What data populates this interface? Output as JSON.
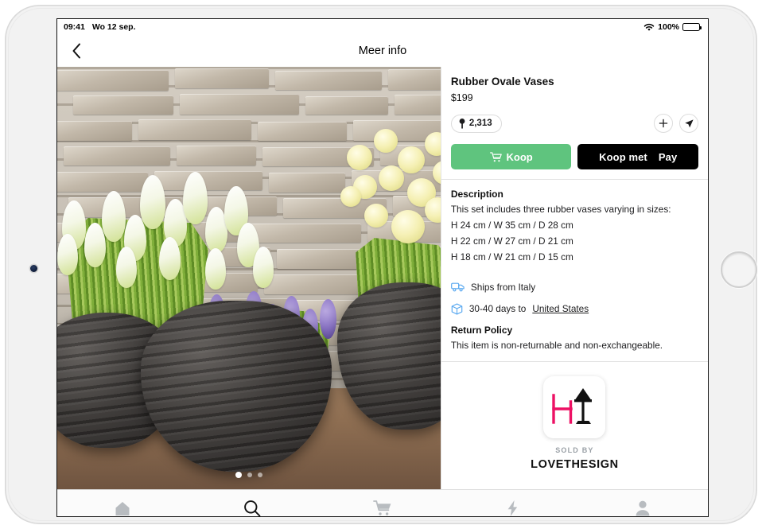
{
  "status_bar": {
    "time": "09:41",
    "date": "Wo 12 sep.",
    "wifi_icon": "wifi-icon",
    "battery_percent": "100%",
    "battery_icon": "battery-full-icon"
  },
  "nav": {
    "back_icon": "chevron-left-icon",
    "title": "Meer info"
  },
  "gallery": {
    "image_alt": "Three dark rubber vases with white tulips, purple grape hyacinths and cream ranunculus against a stone brick wall",
    "dots": [
      {
        "active": true
      },
      {
        "active": false
      },
      {
        "active": false
      }
    ]
  },
  "product": {
    "title": "Rubber Ovale Vases",
    "price": "$199",
    "like_count": "2,313",
    "like_icon": "pin-icon",
    "add_icon": "plus-icon",
    "share_icon": "send-icon",
    "buy_button": {
      "label": "Koop",
      "icon": "cart-icon",
      "color": "#5fc47e"
    },
    "apple_pay_button": {
      "prefix": "Koop met",
      "apple_logo": "",
      "suffix": "Pay",
      "color": "#000000"
    }
  },
  "description": {
    "heading": "Description",
    "lines": [
      "This set includes three rubber vases varying in sizes:",
      "H 24 cm / W 35 cm / D 28 cm",
      "H 22 cm / W 27 cm / D 21 cm",
      "H 18 cm / W 21 cm / D 15 cm"
    ]
  },
  "shipping": {
    "ships_from": {
      "icon": "truck-icon",
      "text": "Ships from Italy",
      "icon_color": "#5aa9f0"
    },
    "delivery": {
      "icon": "box-icon",
      "text": "30-40 days to",
      "destination": "United States",
      "icon_color": "#5aa9f0"
    }
  },
  "return_policy": {
    "heading": "Return Policy",
    "text": "This item is non-returnable and non-exchangeable."
  },
  "seller": {
    "logo_icon": "chair-and-lamp-logo",
    "logo_chair_color": "#ed1164",
    "logo_lamp_color": "#111111",
    "sold_by_label": "SOLD BY",
    "name": "LOVETHESIGN"
  },
  "tabbar": {
    "items": [
      {
        "name": "tab-home",
        "icon": "home-icon",
        "active": false
      },
      {
        "name": "tab-search",
        "icon": "search-icon",
        "active": true
      },
      {
        "name": "tab-cart",
        "icon": "cart-icon",
        "active": false
      },
      {
        "name": "tab-deals",
        "icon": "bolt-icon",
        "active": false
      },
      {
        "name": "tab-profile",
        "icon": "person-icon",
        "active": false
      }
    ]
  }
}
